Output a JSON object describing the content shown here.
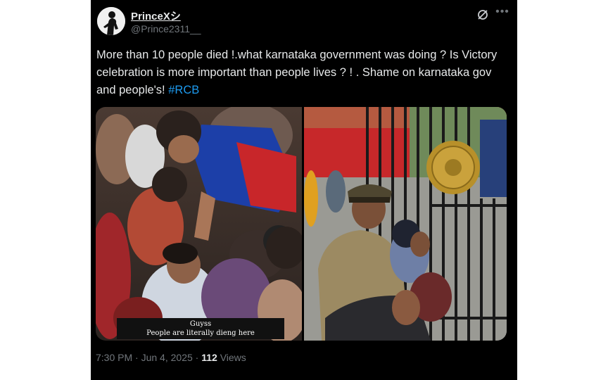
{
  "author": {
    "display_name": "PrinceXシ",
    "handle": "@Prince2311__"
  },
  "post": {
    "text": "More than 10 people died !.what karnataka government was doing ? Is Victory celebration is more important than people lives ? ! . Shame on karnataka gov and people's! ",
    "hashtag": "#RCB"
  },
  "media": {
    "caption_line1": "Guyss",
    "caption_line2": "People are literally dieng here"
  },
  "meta": {
    "time": "7:30 PM",
    "separator1": " · ",
    "date": "Jun 4, 2025",
    "separator2": " · ",
    "views_count": "112",
    "views_label": " Views"
  },
  "icons": {
    "grok": "grok-icon",
    "more": "more-icon"
  },
  "colors": {
    "background": "#000000",
    "text": "#e7e9ea",
    "secondary": "#71767b",
    "link": "#1d9bf0"
  }
}
